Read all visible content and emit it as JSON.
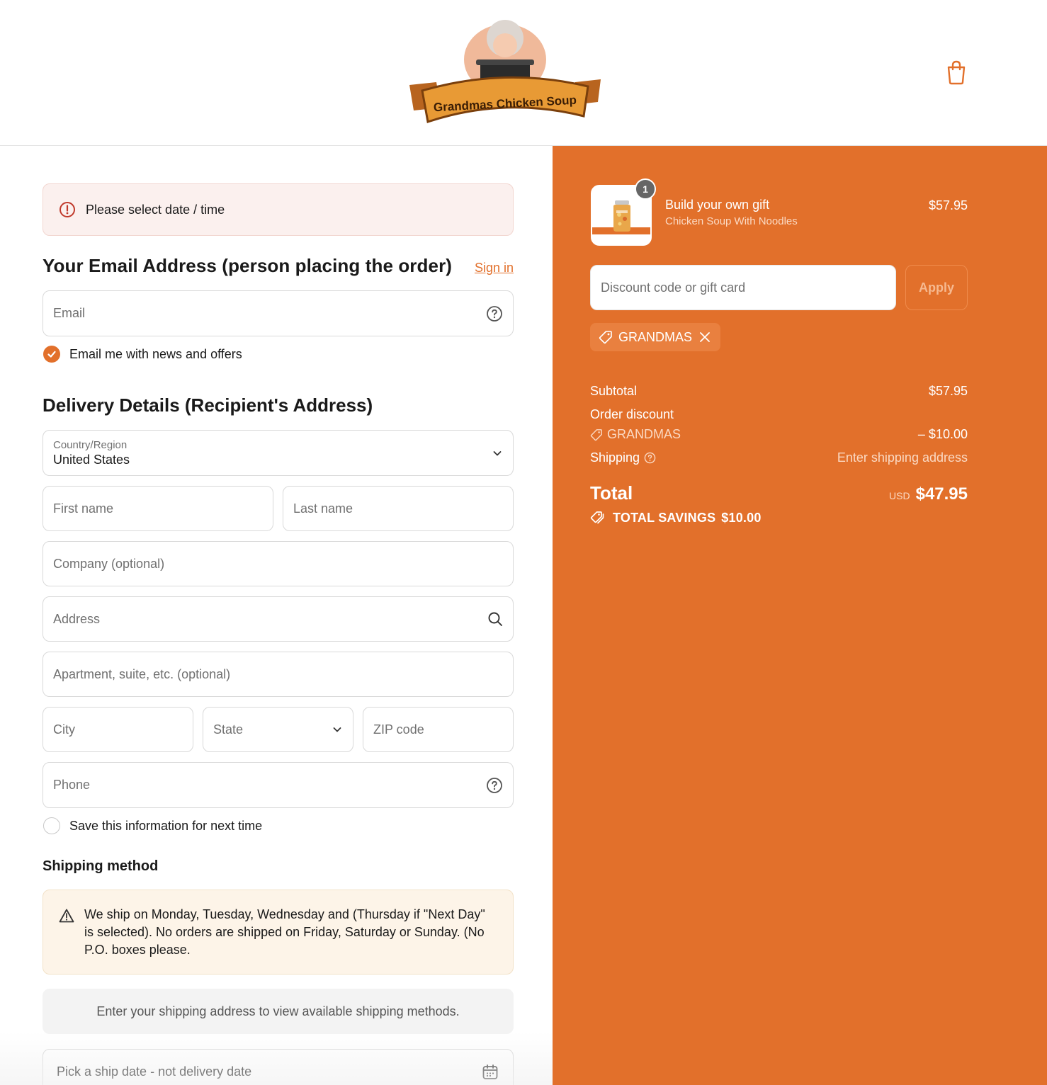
{
  "header": {
    "logo_text": "Grandmas Chicken Soup",
    "cart_icon": "shopping-bag-icon"
  },
  "alert": {
    "message": "Please select date / time",
    "icon": "error-circle-icon"
  },
  "contact": {
    "heading": "Your Email Address (person placing the order)",
    "sign_in": "Sign in",
    "email_placeholder": "Email",
    "newsletter_label": "Email me with news and offers",
    "newsletter_checked": true
  },
  "delivery": {
    "heading": "Delivery Details (Recipient's Address)",
    "country_label": "Country/Region",
    "country_value": "United States",
    "first_name": "First name",
    "last_name": "Last name",
    "company": "Company (optional)",
    "address": "Address",
    "apartment": "Apartment, suite, etc. (optional)",
    "city": "City",
    "state": "State",
    "zip": "ZIP code",
    "phone": "Phone",
    "save_info_label": "Save this information for next time",
    "save_info_checked": false
  },
  "shipping": {
    "heading": "Shipping method",
    "warning": "We ship on Monday, Tuesday, Wednesday and (Thursday if \"Next Day\" is selected). No orders are shipped on Friday, Saturday or Sunday. (No P.O. boxes please.",
    "empty_message": "Enter your shipping address to view available shipping methods.",
    "ship_date_label": "Pick a ship date - not delivery date"
  },
  "summary": {
    "item": {
      "quantity": "1",
      "name": "Build your own gift",
      "variant": "Chicken Soup With Noodles",
      "price": "$57.95"
    },
    "discount_placeholder": "Discount code or gift card",
    "apply_label": "Apply",
    "applied_code": "GRANDMAS",
    "subtotal_label": "Subtotal",
    "subtotal_value": "$57.95",
    "order_discount_label": "Order discount",
    "order_discount_code": "GRANDMAS",
    "order_discount_value": "– $10.00",
    "shipping_label": "Shipping",
    "shipping_value": "Enter shipping address",
    "total_label": "Total",
    "currency": "USD",
    "total_value": "$47.95",
    "savings_label": "TOTAL SAVINGS",
    "savings_value": "$10.00"
  },
  "colors": {
    "accent": "#e2702b",
    "error_bg": "#fbf0ee",
    "warning_bg": "#fdf4e8"
  }
}
